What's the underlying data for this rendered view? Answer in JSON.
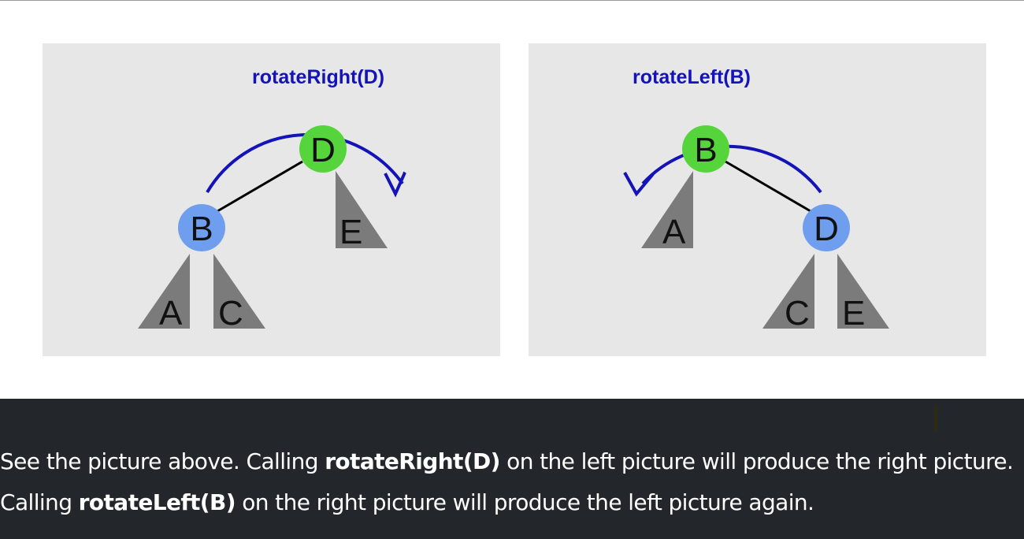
{
  "diagram": {
    "left_panel": {
      "operation_label": "rotateRight(D)",
      "nodes": {
        "root": "D",
        "child": "B"
      },
      "subtrees": {
        "a": "A",
        "c": "C",
        "e": "E"
      }
    },
    "right_panel": {
      "operation_label": "rotateLeft(B)",
      "nodes": {
        "root": "B",
        "child": "D"
      },
      "subtrees": {
        "a": "A",
        "c": "C",
        "e": "E"
      }
    },
    "colors": {
      "panel_bg": "#e7e7e7",
      "arrow": "#1313b8",
      "root_node": "#55d43c",
      "child_node": "#6f9eef",
      "subtree": "#7b7b7b"
    }
  },
  "caption": {
    "part1": "See the picture above. Calling ",
    "op1": "rotateRight(D)",
    "part2": " on the left picture will produce the right picture. Calling ",
    "op2": "rotateLeft(B)",
    "part3": " on the right picture will produce the left picture again."
  }
}
